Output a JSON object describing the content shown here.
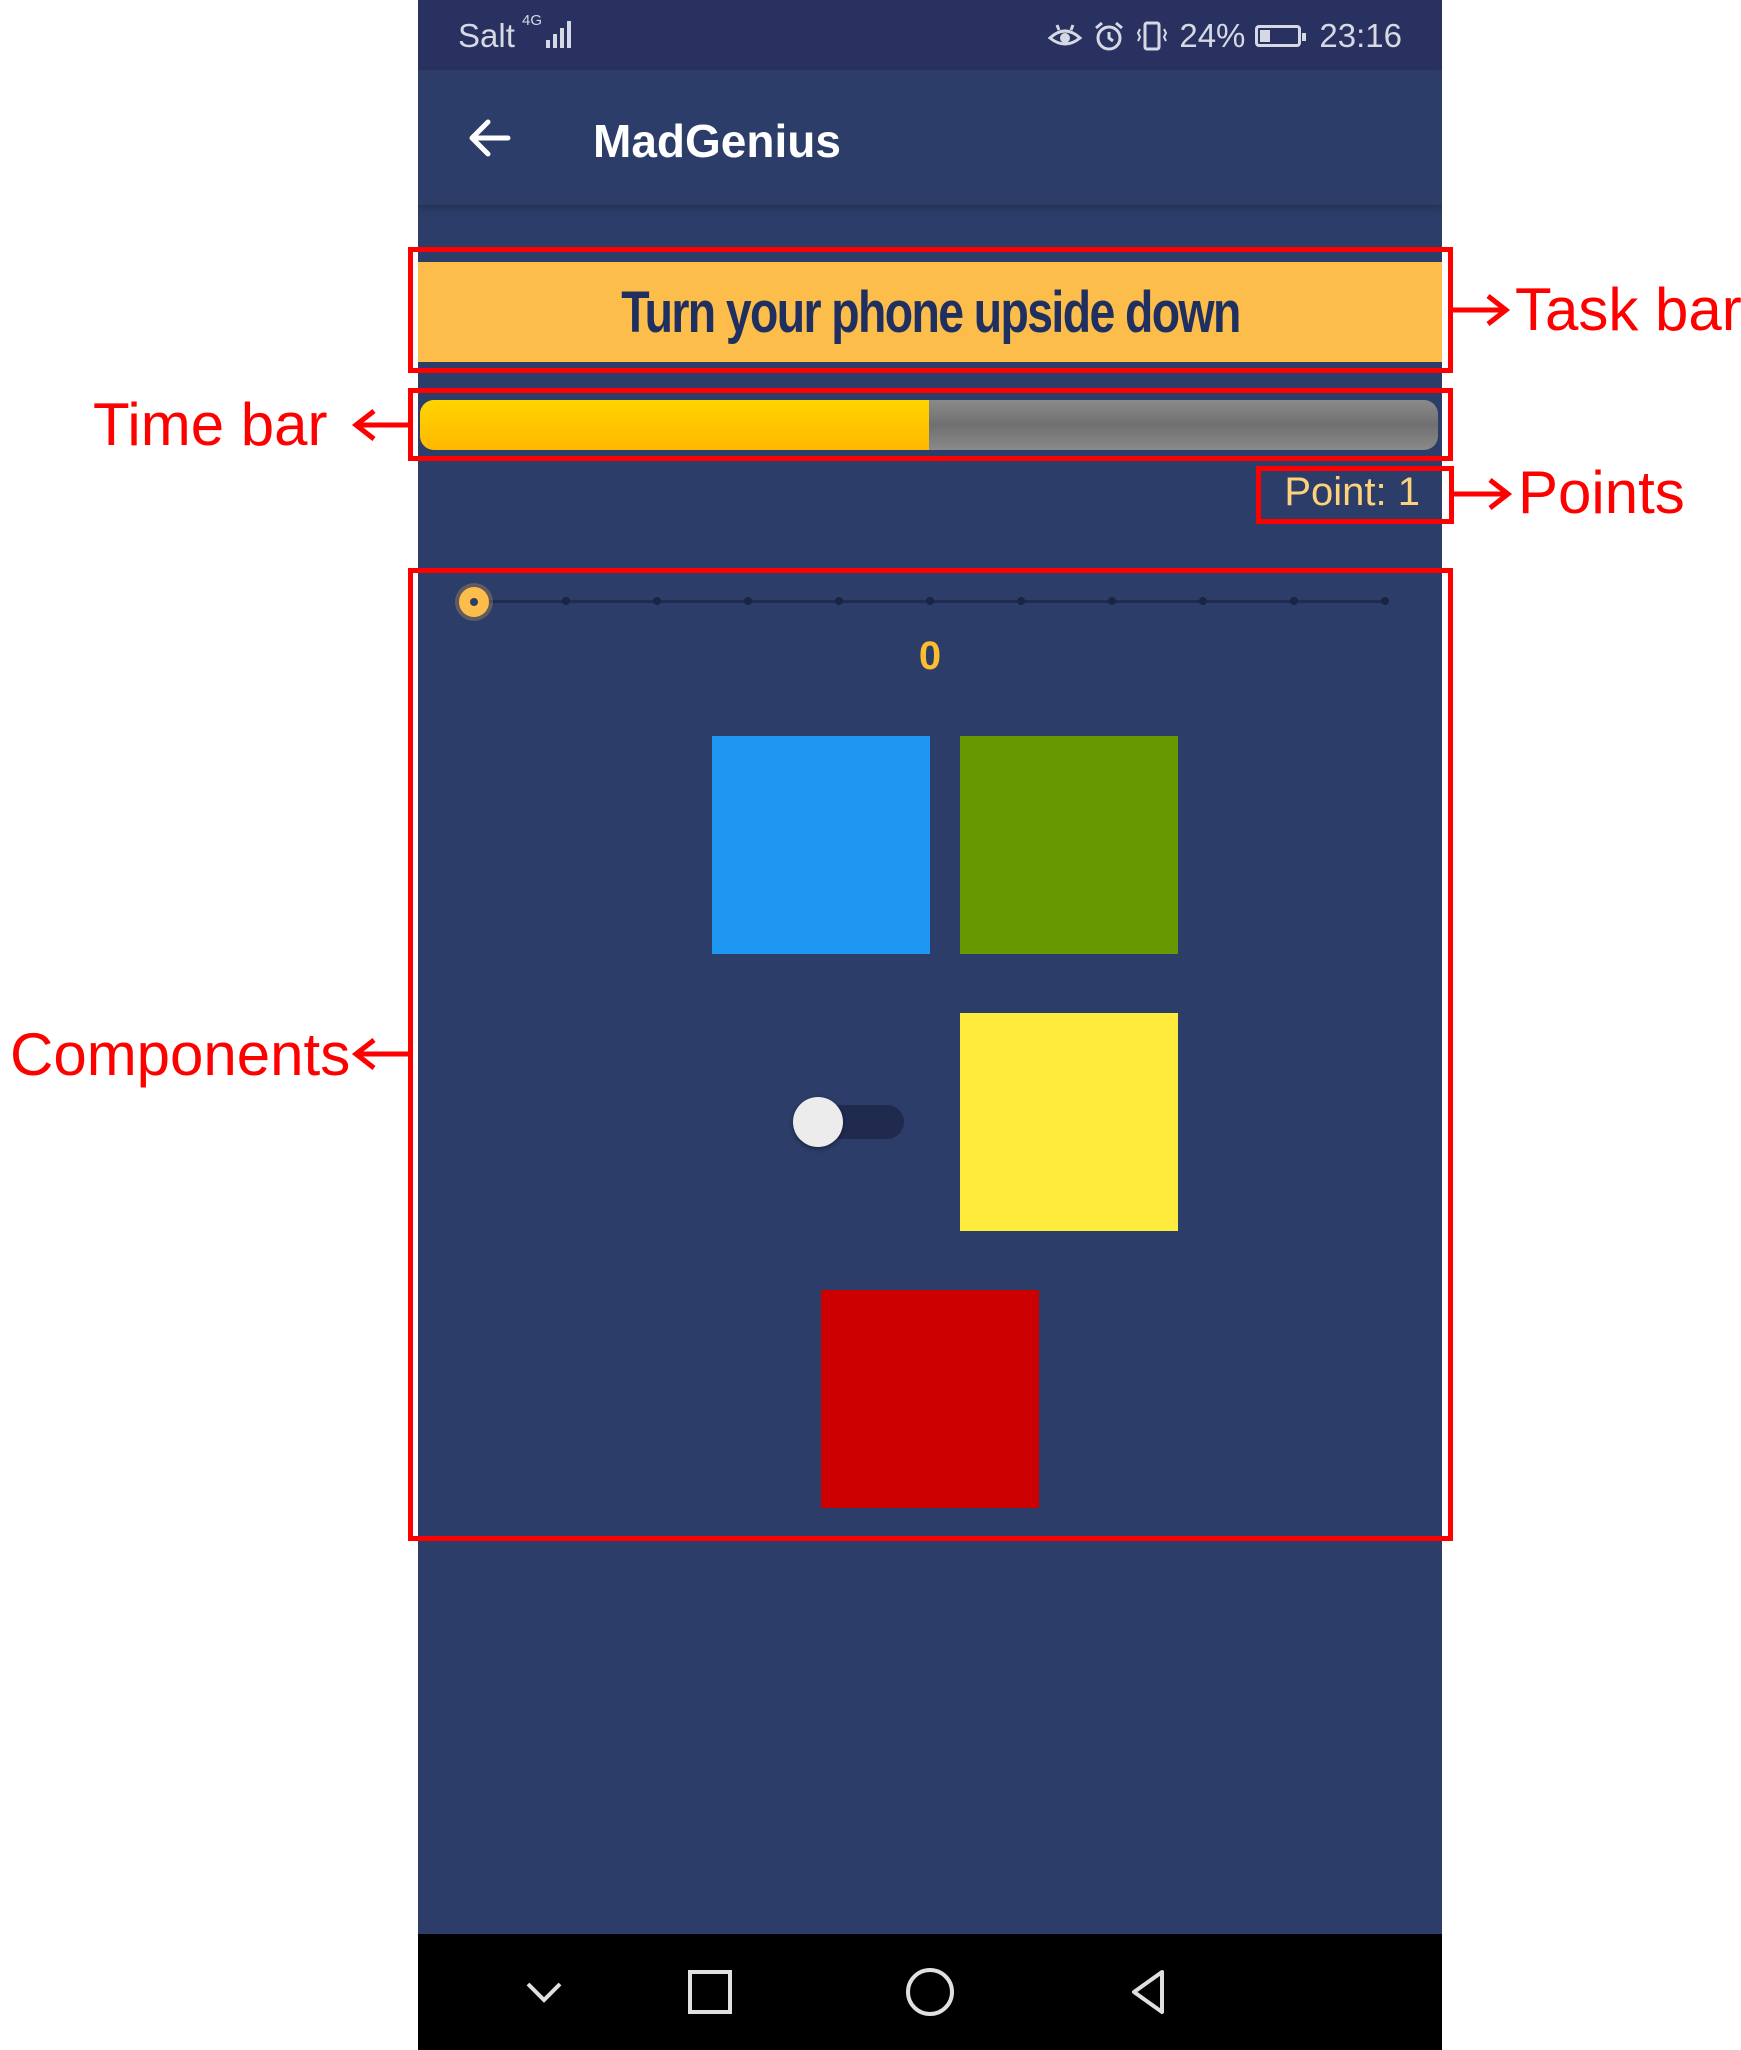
{
  "status_bar": {
    "carrier": "Salt",
    "network": "4G",
    "battery": "24%",
    "time": "23:16"
  },
  "app_bar": {
    "title": "MadGenius"
  },
  "task": {
    "text": "Turn your phone upside down"
  },
  "timer": {
    "progress_fraction": 0.5
  },
  "points": {
    "text": "Point: 1"
  },
  "slider": {
    "value": "0",
    "tick_count": 11
  },
  "squares": {
    "blue": "#1e97f3",
    "green": "#669900",
    "yellow": "#ffeb3b",
    "red": "#cc0000"
  },
  "toggle": {
    "state": "off"
  },
  "nav_bar": {
    "icons": [
      "chevron-down-icon",
      "square-icon",
      "circle-icon",
      "triangle-back-icon"
    ]
  },
  "annotations": {
    "task_bar": "Task bar",
    "time_bar": "Time bar",
    "points": "Points",
    "components": "Components"
  }
}
